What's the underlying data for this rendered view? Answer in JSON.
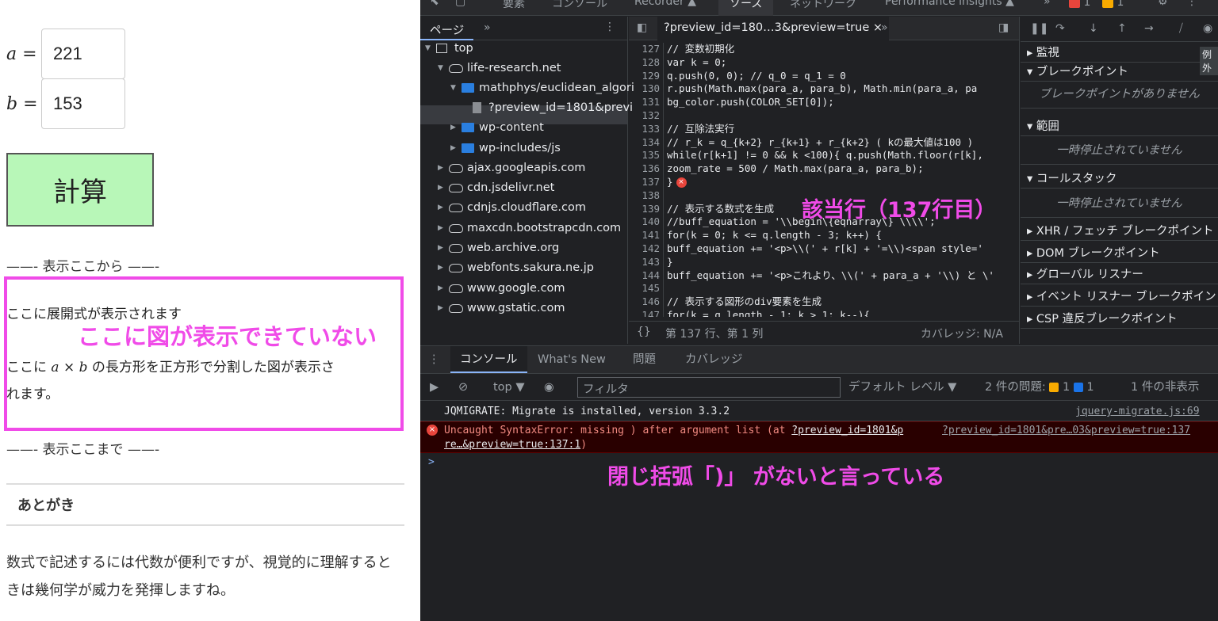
{
  "left": {
    "var_a_label": "a",
    "var_b_label": "b",
    "equals": "=",
    "input_a_value": "221",
    "input_b_value": "153",
    "calc_button": "計算",
    "display_start": "——- 表示ここから ——-",
    "display_end": "——- 表示ここまで ——-",
    "expansion_note": "ここに展開式が表示されます",
    "figure_note_prefix": "ここに",
    "figure_note_math_a": "a",
    "figure_note_times": "×",
    "figure_note_math_b": "b",
    "figure_note_suffix": "の長方形を正方形で分割した図が表示さ",
    "figure_note_line2": "れます。",
    "annotation_no_figure": "ここに図が表示できていない",
    "afterword_heading": "あとがき",
    "closing_text": "数式で記述するには代数が便利ですが、視覚的に理解するときは幾何学が威力を発揮しますね。"
  },
  "devtools": {
    "top_tabs": [
      "要素",
      "コンソール",
      "Recorder ▲",
      "ソース",
      "ネットワーク",
      "Performance insights ▲",
      "»"
    ],
    "active_top_tab": "ソース",
    "error_count": "1",
    "warning_count": "1",
    "pages_tab": "ページ",
    "pages_more": "»",
    "tree": [
      {
        "label": "top",
        "level": 0,
        "type": "frame"
      },
      {
        "label": "life-research.net",
        "level": 1,
        "type": "cloud"
      },
      {
        "label": "mathphys/euclidean_algori",
        "level": 2,
        "type": "folder"
      },
      {
        "label": "?preview_id=1801&previ",
        "level": 3,
        "type": "file"
      },
      {
        "label": "wp-content",
        "level": 2,
        "type": "folder"
      },
      {
        "label": "wp-includes/js",
        "level": 2,
        "type": "folder"
      },
      {
        "label": "ajax.googleapis.com",
        "level": 1,
        "type": "cloud"
      },
      {
        "label": "cdn.jsdelivr.net",
        "level": 1,
        "type": "cloud"
      },
      {
        "label": "cdnjs.cloudflare.com",
        "level": 1,
        "type": "cloud"
      },
      {
        "label": "maxcdn.bootstrapcdn.com",
        "level": 1,
        "type": "cloud"
      },
      {
        "label": "web.archive.org",
        "level": 1,
        "type": "cloud"
      },
      {
        "label": "webfonts.sakura.ne.jp",
        "level": 1,
        "type": "cloud"
      },
      {
        "label": "www.google.com",
        "level": 1,
        "type": "cloud"
      },
      {
        "label": "www.gstatic.com",
        "level": 1,
        "type": "cloud"
      }
    ],
    "source_tab": "?preview_id=180…3&preview=true",
    "code_lines": [
      {
        "n": "127",
        "t": "// 変数初期化"
      },
      {
        "n": "128",
        "t": "var k = 0;"
      },
      {
        "n": "129",
        "t": "q.push(0, 0); // q_0 = q_1 = 0"
      },
      {
        "n": "130",
        "t": "r.push(Math.max(para_a, para_b), Math.min(para_a, pa"
      },
      {
        "n": "131",
        "t": "bg_color.push(COLOR_SET[0]);"
      },
      {
        "n": "132",
        "t": ""
      },
      {
        "n": "133",
        "t": "// 互除法実行"
      },
      {
        "n": "134",
        "t": "// r_k = q_{k+2} r_{k+1} + r_{k+2} ( kの最大値は100 )"
      },
      {
        "n": "135",
        "t": "while(r[k+1] != 0 && k <100){ q.push(Math.floor(r[k],"
      },
      {
        "n": "136",
        "t": "zoom_rate = 500 / Math.max(para_a, para_b);"
      },
      {
        "n": "137",
        "t": "}"
      },
      {
        "n": "138",
        "t": ""
      },
      {
        "n": "139",
        "t": "// 表示する数式を生成"
      },
      {
        "n": "140",
        "t": "//buff_equation = '\\\\begin\\{eqnarray\\} \\\\\\\\';"
      },
      {
        "n": "141",
        "t": "for(k = 0; k <= q.length - 3; k++) {"
      },
      {
        "n": "142",
        "t": "buff_equation += '<p>\\\\(' + r[k] + '=\\\\)<span style='"
      },
      {
        "n": "143",
        "t": "}"
      },
      {
        "n": "144",
        "t": "buff_equation += '<p>これより、\\\\(' + para_a + '\\\\) と \\'"
      },
      {
        "n": "145",
        "t": ""
      },
      {
        "n": "146",
        "t": "// 表示する図形のdiv要素を生成"
      },
      {
        "n": "147",
        "t": "for(k = q.length - 1; k > 1; k--){"
      }
    ],
    "annotation_line": "該当行（137行目）",
    "status_position": "第 137 行、第 1 列",
    "status_coverage": "カバレッジ: N/A",
    "right_sections": {
      "watch": "監視",
      "breakpoints": "ブレークポイント",
      "no_breakpoints": "ブレークポイントがありません",
      "scope": "範囲",
      "not_paused_1": "一時停止されていません",
      "call_stack": "コールスタック",
      "not_paused_2": "一時停止されていません",
      "xhr": "XHR / フェッチ ブレークポイント",
      "dom": "DOM ブレークポイント",
      "global": "グローバル リスナー",
      "event": "イベント リスナー ブレークポイン",
      "csp": "CSP 違反ブレークポイント",
      "example": "例外"
    },
    "console_tabs": [
      "コンソール",
      "What's New",
      "問題",
      "カバレッジ"
    ],
    "context": "top ▼",
    "filter_placeholder": "フィルタ",
    "default_level": "デフォルト レベル ▼",
    "issues_label": "2 件の問題:",
    "issue_warn_count": "1",
    "issue_info_count": "1",
    "hidden_count": "1 件の非表示",
    "msg_info": "JQMIGRATE: Migrate is installed, version 3.3.2",
    "msg_info_src": "jquery-migrate.js:69",
    "msg_err_prefix": "Uncaught SyntaxError: missing ) after argument list (at ",
    "msg_err_link": "?preview_id=1801&p",
    "msg_err_src": "?preview_id=1801&pre…03&preview=true:137",
    "msg_err_line2_link": "re…&preview=true:137:1",
    "msg_err_line2_close": ")",
    "prompt": ">",
    "annotation_console": "閉じ括弧「)」 がないと言っている"
  },
  "colors": {
    "annotation": "#f04be8",
    "calc_button_bg": "#b8f7b8",
    "devtools_bg": "#202124"
  }
}
